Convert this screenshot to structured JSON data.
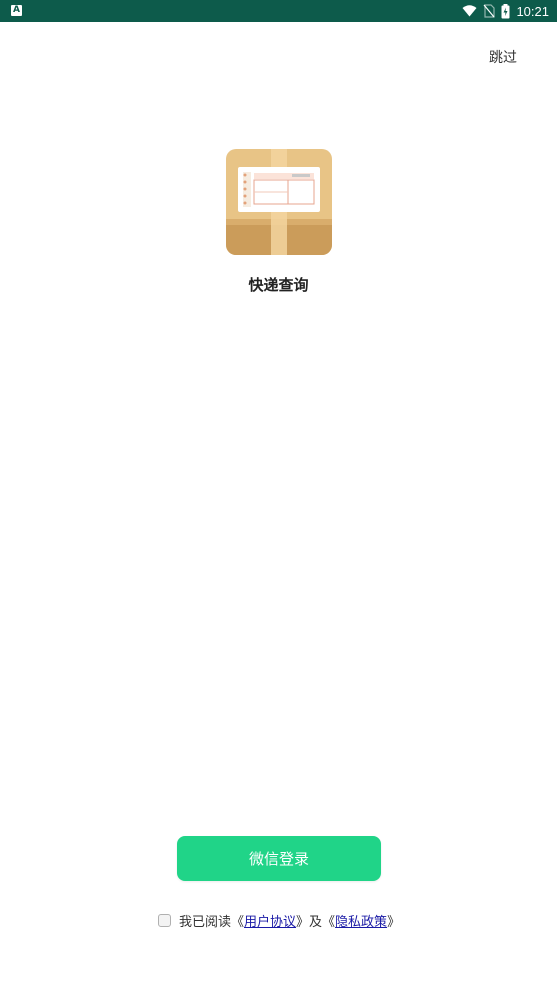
{
  "status_bar": {
    "left_icon": "A",
    "time": "10:21",
    "icons": [
      "wifi-icon",
      "no-sim-icon",
      "battery-charging-icon"
    ],
    "background": "#0d5b4b"
  },
  "header": {
    "skip_label": "跳过"
  },
  "app": {
    "name": "快递查询",
    "logo_icon": "package-box-icon"
  },
  "login": {
    "wechat_label": "微信登录",
    "accent": "#20d488"
  },
  "agreement": {
    "prefix": "我已阅读《",
    "user_agreement": "用户协议",
    "middle": "》及《",
    "privacy_policy": "隐私政策",
    "suffix": "》",
    "checked": false
  }
}
